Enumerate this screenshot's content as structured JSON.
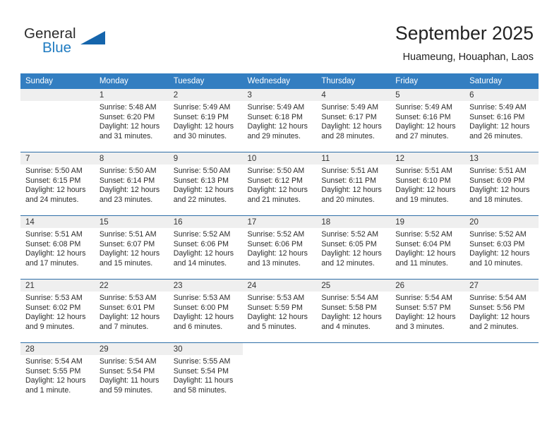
{
  "brand": {
    "name_part1": "General",
    "name_part2": "Blue",
    "triangle_color": "#1565ac",
    "blue_color": "#1f7bc1"
  },
  "header": {
    "month_title": "September 2025",
    "location": "Huameung, Houaphan, Laos"
  },
  "theme": {
    "header_row_bg": "#337ec1",
    "daynum_bg": "#efefef",
    "row_border": "#2f6fa8"
  },
  "weekdays": [
    "Sunday",
    "Monday",
    "Tuesday",
    "Wednesday",
    "Thursday",
    "Friday",
    "Saturday"
  ],
  "labels": {
    "sunrise_prefix": "Sunrise:",
    "sunset_prefix": "Sunset:",
    "daylight_prefix": "Daylight:"
  },
  "weeks": [
    [
      {
        "day": "",
        "sunrise": "",
        "sunset": "",
        "daylight_line1": "",
        "daylight_line2": ""
      },
      {
        "day": "1",
        "sunrise": "Sunrise: 5:48 AM",
        "sunset": "Sunset: 6:20 PM",
        "daylight_line1": "Daylight: 12 hours",
        "daylight_line2": "and 31 minutes."
      },
      {
        "day": "2",
        "sunrise": "Sunrise: 5:49 AM",
        "sunset": "Sunset: 6:19 PM",
        "daylight_line1": "Daylight: 12 hours",
        "daylight_line2": "and 30 minutes."
      },
      {
        "day": "3",
        "sunrise": "Sunrise: 5:49 AM",
        "sunset": "Sunset: 6:18 PM",
        "daylight_line1": "Daylight: 12 hours",
        "daylight_line2": "and 29 minutes."
      },
      {
        "day": "4",
        "sunrise": "Sunrise: 5:49 AM",
        "sunset": "Sunset: 6:17 PM",
        "daylight_line1": "Daylight: 12 hours",
        "daylight_line2": "and 28 minutes."
      },
      {
        "day": "5",
        "sunrise": "Sunrise: 5:49 AM",
        "sunset": "Sunset: 6:16 PM",
        "daylight_line1": "Daylight: 12 hours",
        "daylight_line2": "and 27 minutes."
      },
      {
        "day": "6",
        "sunrise": "Sunrise: 5:49 AM",
        "sunset": "Sunset: 6:16 PM",
        "daylight_line1": "Daylight: 12 hours",
        "daylight_line2": "and 26 minutes."
      }
    ],
    [
      {
        "day": "7",
        "sunrise": "Sunrise: 5:50 AM",
        "sunset": "Sunset: 6:15 PM",
        "daylight_line1": "Daylight: 12 hours",
        "daylight_line2": "and 24 minutes."
      },
      {
        "day": "8",
        "sunrise": "Sunrise: 5:50 AM",
        "sunset": "Sunset: 6:14 PM",
        "daylight_line1": "Daylight: 12 hours",
        "daylight_line2": "and 23 minutes."
      },
      {
        "day": "9",
        "sunrise": "Sunrise: 5:50 AM",
        "sunset": "Sunset: 6:13 PM",
        "daylight_line1": "Daylight: 12 hours",
        "daylight_line2": "and 22 minutes."
      },
      {
        "day": "10",
        "sunrise": "Sunrise: 5:50 AM",
        "sunset": "Sunset: 6:12 PM",
        "daylight_line1": "Daylight: 12 hours",
        "daylight_line2": "and 21 minutes."
      },
      {
        "day": "11",
        "sunrise": "Sunrise: 5:51 AM",
        "sunset": "Sunset: 6:11 PM",
        "daylight_line1": "Daylight: 12 hours",
        "daylight_line2": "and 20 minutes."
      },
      {
        "day": "12",
        "sunrise": "Sunrise: 5:51 AM",
        "sunset": "Sunset: 6:10 PM",
        "daylight_line1": "Daylight: 12 hours",
        "daylight_line2": "and 19 minutes."
      },
      {
        "day": "13",
        "sunrise": "Sunrise: 5:51 AM",
        "sunset": "Sunset: 6:09 PM",
        "daylight_line1": "Daylight: 12 hours",
        "daylight_line2": "and 18 minutes."
      }
    ],
    [
      {
        "day": "14",
        "sunrise": "Sunrise: 5:51 AM",
        "sunset": "Sunset: 6:08 PM",
        "daylight_line1": "Daylight: 12 hours",
        "daylight_line2": "and 17 minutes."
      },
      {
        "day": "15",
        "sunrise": "Sunrise: 5:51 AM",
        "sunset": "Sunset: 6:07 PM",
        "daylight_line1": "Daylight: 12 hours",
        "daylight_line2": "and 15 minutes."
      },
      {
        "day": "16",
        "sunrise": "Sunrise: 5:52 AM",
        "sunset": "Sunset: 6:06 PM",
        "daylight_line1": "Daylight: 12 hours",
        "daylight_line2": "and 14 minutes."
      },
      {
        "day": "17",
        "sunrise": "Sunrise: 5:52 AM",
        "sunset": "Sunset: 6:06 PM",
        "daylight_line1": "Daylight: 12 hours",
        "daylight_line2": "and 13 minutes."
      },
      {
        "day": "18",
        "sunrise": "Sunrise: 5:52 AM",
        "sunset": "Sunset: 6:05 PM",
        "daylight_line1": "Daylight: 12 hours",
        "daylight_line2": "and 12 minutes."
      },
      {
        "day": "19",
        "sunrise": "Sunrise: 5:52 AM",
        "sunset": "Sunset: 6:04 PM",
        "daylight_line1": "Daylight: 12 hours",
        "daylight_line2": "and 11 minutes."
      },
      {
        "day": "20",
        "sunrise": "Sunrise: 5:52 AM",
        "sunset": "Sunset: 6:03 PM",
        "daylight_line1": "Daylight: 12 hours",
        "daylight_line2": "and 10 minutes."
      }
    ],
    [
      {
        "day": "21",
        "sunrise": "Sunrise: 5:53 AM",
        "sunset": "Sunset: 6:02 PM",
        "daylight_line1": "Daylight: 12 hours",
        "daylight_line2": "and 9 minutes."
      },
      {
        "day": "22",
        "sunrise": "Sunrise: 5:53 AM",
        "sunset": "Sunset: 6:01 PM",
        "daylight_line1": "Daylight: 12 hours",
        "daylight_line2": "and 7 minutes."
      },
      {
        "day": "23",
        "sunrise": "Sunrise: 5:53 AM",
        "sunset": "Sunset: 6:00 PM",
        "daylight_line1": "Daylight: 12 hours",
        "daylight_line2": "and 6 minutes."
      },
      {
        "day": "24",
        "sunrise": "Sunrise: 5:53 AM",
        "sunset": "Sunset: 5:59 PM",
        "daylight_line1": "Daylight: 12 hours",
        "daylight_line2": "and 5 minutes."
      },
      {
        "day": "25",
        "sunrise": "Sunrise: 5:54 AM",
        "sunset": "Sunset: 5:58 PM",
        "daylight_line1": "Daylight: 12 hours",
        "daylight_line2": "and 4 minutes."
      },
      {
        "day": "26",
        "sunrise": "Sunrise: 5:54 AM",
        "sunset": "Sunset: 5:57 PM",
        "daylight_line1": "Daylight: 12 hours",
        "daylight_line2": "and 3 minutes."
      },
      {
        "day": "27",
        "sunrise": "Sunrise: 5:54 AM",
        "sunset": "Sunset: 5:56 PM",
        "daylight_line1": "Daylight: 12 hours",
        "daylight_line2": "and 2 minutes."
      }
    ],
    [
      {
        "day": "28",
        "sunrise": "Sunrise: 5:54 AM",
        "sunset": "Sunset: 5:55 PM",
        "daylight_line1": "Daylight: 12 hours",
        "daylight_line2": "and 1 minute."
      },
      {
        "day": "29",
        "sunrise": "Sunrise: 5:54 AM",
        "sunset": "Sunset: 5:54 PM",
        "daylight_line1": "Daylight: 11 hours",
        "daylight_line2": "and 59 minutes."
      },
      {
        "day": "30",
        "sunrise": "Sunrise: 5:55 AM",
        "sunset": "Sunset: 5:54 PM",
        "daylight_line1": "Daylight: 11 hours",
        "daylight_line2": "and 58 minutes."
      },
      {
        "day": "",
        "sunrise": "",
        "sunset": "",
        "daylight_line1": "",
        "daylight_line2": ""
      },
      {
        "day": "",
        "sunrise": "",
        "sunset": "",
        "daylight_line1": "",
        "daylight_line2": ""
      },
      {
        "day": "",
        "sunrise": "",
        "sunset": "",
        "daylight_line1": "",
        "daylight_line2": ""
      },
      {
        "day": "",
        "sunrise": "",
        "sunset": "",
        "daylight_line1": "",
        "daylight_line2": ""
      }
    ]
  ]
}
